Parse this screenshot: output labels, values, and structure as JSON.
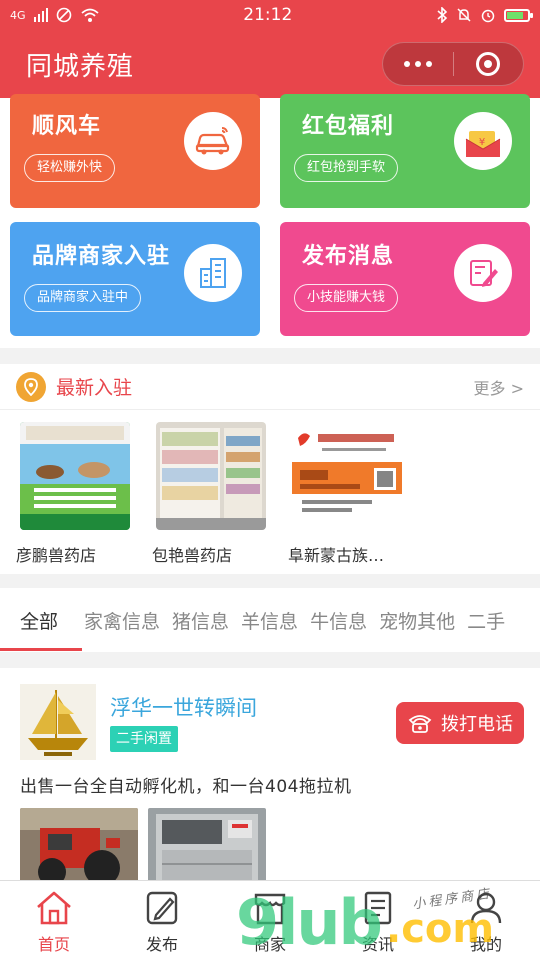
{
  "status_bar": {
    "time": "21:12",
    "network": "4G"
  },
  "header": {
    "title": "同城养殖"
  },
  "feature_cards": [
    {
      "title": "顺风车",
      "pill": "轻松赚外快",
      "color": "#f0663f",
      "icon": "car-icon"
    },
    {
      "title": "红包福利",
      "pill": "红包抢到手软",
      "color": "#5cc45c",
      "icon": "red-envelope-icon"
    },
    {
      "title": "品牌商家入驻",
      "pill": "品牌商家入驻中",
      "color": "#4ea3f0",
      "icon": "building-icon"
    },
    {
      "title": "发布消息",
      "pill": "小技能赚大钱",
      "color": "#f04a8f",
      "icon": "edit-document-icon"
    }
  ],
  "newest": {
    "title": "最新入驻",
    "more": "更多 >",
    "shops": [
      {
        "name": "彦鹏兽药店",
        "image": "shop-sign-photo"
      },
      {
        "name": "包艳兽药店",
        "image": "pharmacy-shelves-photo"
      },
      {
        "name": "阜新蒙古族…",
        "image": "business-card-photo"
      }
    ]
  },
  "tabs": [
    "全部",
    "家禽信息",
    "猪信息",
    "羊信息",
    "牛信息",
    "宠物其他",
    "二手"
  ],
  "post": {
    "user": "浮华一世转瞬间",
    "tag": "二手闲置",
    "call_label": "拨打电话",
    "text": "出售一台全自动孵化机，和一台404拖拉机"
  },
  "bottom_nav": [
    {
      "label": "首页",
      "icon": "home-icon",
      "active": true
    },
    {
      "label": "发布",
      "icon": "edit-icon",
      "active": false
    },
    {
      "label": "商家",
      "icon": "shop-icon",
      "active": false
    },
    {
      "label": "资讯",
      "icon": "news-icon",
      "active": false
    },
    {
      "label": "我的",
      "icon": "user-icon",
      "active": false
    }
  ],
  "watermark": {
    "logo": "9lub",
    "domain": ".com",
    "handwriting": "小程序商店"
  },
  "colors": {
    "brand_red": "#e8454b",
    "link_blue": "#3aa6dc",
    "tag_teal": "#2cd1b5",
    "pin_orange": "#f0a533"
  }
}
